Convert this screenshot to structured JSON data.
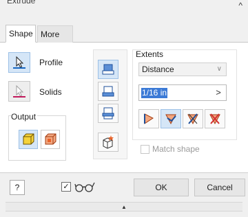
{
  "dialog": {
    "title": "Extrude",
    "collapse_glyph": "^"
  },
  "tabs": [
    {
      "label": "Shape",
      "active": true
    },
    {
      "label": "More",
      "active": false
    }
  ],
  "selectors": {
    "profile_label": "Profile",
    "solids_label": "Solids",
    "profile_accent": "#1565c0",
    "solids_accent": "#c2185b"
  },
  "output": {
    "label": "Output",
    "solid_icon": "solid-body-icon",
    "surface_icon": "surface-body-icon"
  },
  "direction_icons": [
    "direction-default-icon",
    "direction-flipped-icon",
    "direction-symmetric-icon",
    "direction-asymmetric-icon"
  ],
  "extents": {
    "title": "Extents",
    "type_selected": "Distance",
    "distance_value": "1/16 in",
    "arrow_glyph": ">",
    "end_icons": [
      "extent-new-solid-icon",
      "extent-join-icon",
      "extent-cut-icon",
      "extent-intersect-icon"
    ]
  },
  "match_shape": {
    "label": "Match shape",
    "checked": false
  },
  "footer": {
    "help_glyph": "?",
    "preview_checked": true,
    "ok_label": "OK",
    "cancel_label": "Cancel",
    "expander_glyph": "▲"
  },
  "colors": {
    "active_button_bg": "#d5e6f7",
    "selection_highlight": "#3b7ad6",
    "solid_face": "#f5d23a",
    "surface_face": "#e8632a"
  }
}
